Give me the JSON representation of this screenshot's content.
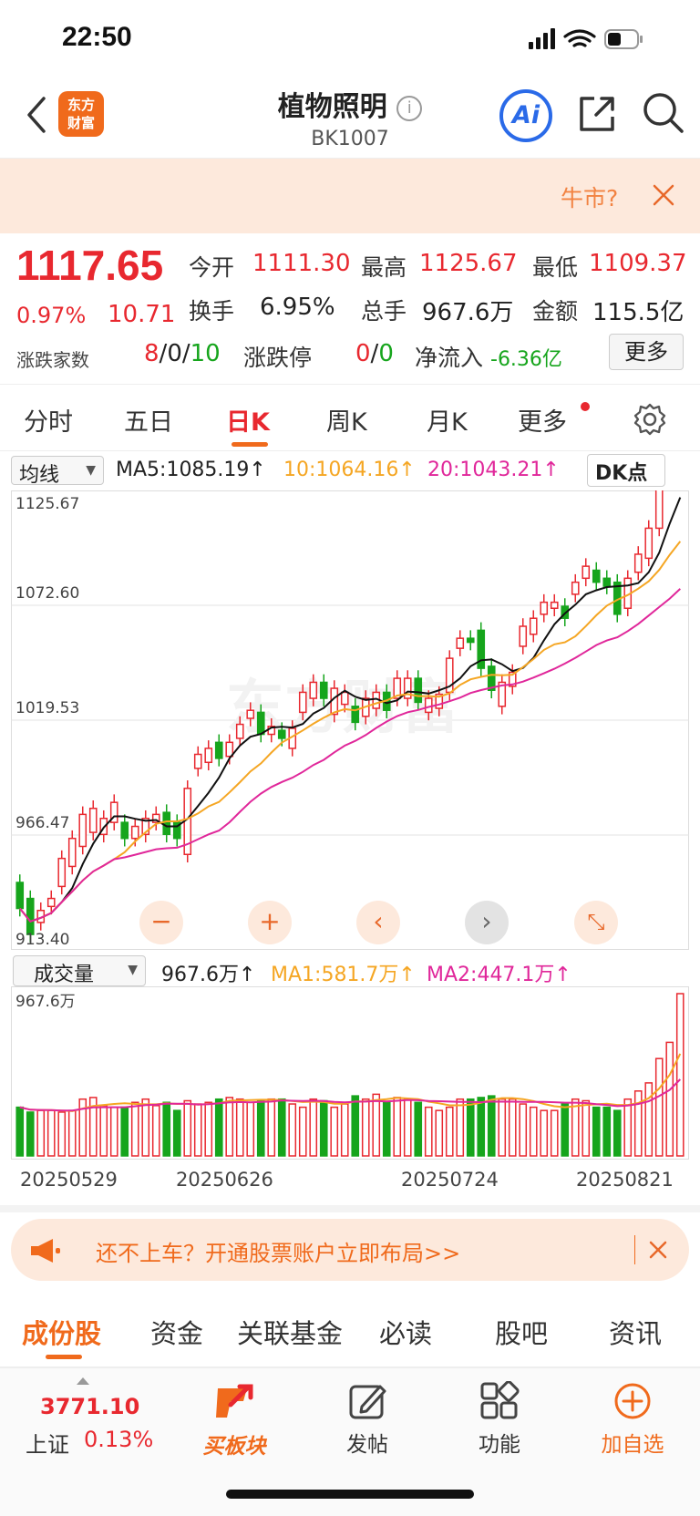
{
  "status_bar": {
    "time": "22:50"
  },
  "header": {
    "title": "植物照明",
    "code": "BK1007",
    "logo_text_1": "东方",
    "logo_text_2": "财富",
    "ai_label": "Ai"
  },
  "banner": {
    "text": "牛市?"
  },
  "quote": {
    "price": "1117.65",
    "change_pct": "0.97%",
    "change": "10.71",
    "open_label": "今开",
    "open": "1111.30",
    "high_label": "最高",
    "high": "1125.67",
    "low_label": "最低",
    "low": "1109.37",
    "turnover_label": "换手",
    "turnover": "6.95%",
    "volume_label": "总手",
    "volume": "967.6万",
    "amount_label": "金额",
    "amount": "115.5亿",
    "updown_label": "涨跌家数",
    "up": "8",
    "flat": "0",
    "down": "10",
    "limit_label": "涨跌停",
    "limit_up": "0",
    "limit_down": "0",
    "netflow_label": "净流入",
    "netflow": "-6.36亿",
    "more_button": "更多",
    "sep": "/"
  },
  "kline_tabs": [
    {
      "label": "分时"
    },
    {
      "label": "五日"
    },
    {
      "label": "日K"
    },
    {
      "label": "周K"
    },
    {
      "label": "月K"
    },
    {
      "label": "更多"
    }
  ],
  "ma_bar": {
    "selector": "均线",
    "ma5": "MA5:1085.19↑",
    "ma10": "10:1064.16↑",
    "ma20": "20:1043.21↑",
    "dk": "DK点"
  },
  "price_axis": [
    "1125.67",
    "1072.60",
    "1019.53",
    "966.47",
    "913.40"
  ],
  "vol_bar": {
    "selector": "成交量",
    "vol": "967.6万↑",
    "ma1": "MA1:581.7万↑",
    "ma2": "MA2:447.1万↑",
    "axis_max": "967.6万"
  },
  "date_axis": [
    "20250529",
    "20250626",
    "20250724",
    "20250821"
  ],
  "watermark": "东方财富",
  "chart_controls": [
    "−",
    "+",
    "‹",
    "›",
    "⤡"
  ],
  "ad": {
    "text": "还不上车？开通股票账户立即布局>>"
  },
  "sub_tabs": [
    {
      "label": "成份股"
    },
    {
      "label": "资金"
    },
    {
      "label": "关联基金"
    },
    {
      "label": "必读"
    },
    {
      "label": "股吧"
    },
    {
      "label": "资讯"
    }
  ],
  "bottom_bar": {
    "index_value": "3771.10",
    "index_name": "上证",
    "index_pct": "0.13%",
    "buy": "买板块",
    "post": "发帖",
    "func": "功能",
    "add": "加自选"
  },
  "colors": {
    "up": "#e8282f",
    "down": "#16a51c",
    "ma10": "#f5a623",
    "ma20": "#e0279a",
    "accent": "#f06a1c"
  },
  "chart_data": {
    "type": "candlestick",
    "ylim": [
      913.4,
      1125.67
    ],
    "candles": [
      {
        "o": 938,
        "c": 925
      },
      {
        "o": 930,
        "c": 912
      },
      {
        "o": 918,
        "c": 924
      },
      {
        "o": 926,
        "c": 930
      },
      {
        "o": 936,
        "c": 950
      },
      {
        "o": 946,
        "c": 960
      },
      {
        "o": 956,
        "c": 972
      },
      {
        "o": 963,
        "c": 975
      },
      {
        "o": 962,
        "c": 970
      },
      {
        "o": 968,
        "c": 978
      },
      {
        "o": 968,
        "c": 960
      },
      {
        "o": 960,
        "c": 966
      },
      {
        "o": 962,
        "c": 970
      },
      {
        "o": 968,
        "c": 972
      },
      {
        "o": 973,
        "c": 962
      },
      {
        "o": 968,
        "c": 960
      },
      {
        "o": 952,
        "c": 985
      },
      {
        "o": 995,
        "c": 1002
      },
      {
        "o": 998,
        "c": 1005
      },
      {
        "o": 1008,
        "c": 1000
      },
      {
        "o": 1001,
        "c": 1008
      },
      {
        "o": 1010,
        "c": 1017
      },
      {
        "o": 1020,
        "c": 1024
      },
      {
        "o": 1023,
        "c": 1012
      },
      {
        "o": 1012,
        "c": 1016
      },
      {
        "o": 1014,
        "c": 1010
      },
      {
        "o": 1005,
        "c": 1015
      },
      {
        "o": 1023,
        "c": 1033
      },
      {
        "o": 1030,
        "c": 1038
      },
      {
        "o": 1038,
        "c": 1030
      },
      {
        "o": 1022,
        "c": 1035
      },
      {
        "o": 1027,
        "c": 1033
      },
      {
        "o": 1026,
        "c": 1018
      },
      {
        "o": 1021,
        "c": 1030
      },
      {
        "o": 1025,
        "c": 1033
      },
      {
        "o": 1033,
        "c": 1024
      },
      {
        "o": 1030,
        "c": 1040
      },
      {
        "o": 1030,
        "c": 1040
      },
      {
        "o": 1040,
        "c": 1028
      },
      {
        "o": 1023,
        "c": 1030
      },
      {
        "o": 1025,
        "c": 1032
      },
      {
        "o": 1033,
        "c": 1050
      },
      {
        "o": 1055,
        "c": 1060
      },
      {
        "o": 1060,
        "c": 1058
      },
      {
        "o": 1064,
        "c": 1045
      },
      {
        "o": 1046,
        "c": 1034
      },
      {
        "o": 1026,
        "c": 1038
      },
      {
        "o": 1036,
        "c": 1043
      },
      {
        "o": 1056,
        "c": 1066
      },
      {
        "o": 1062,
        "c": 1070
      },
      {
        "o": 1072,
        "c": 1078
      },
      {
        "o": 1075,
        "c": 1078
      },
      {
        "o": 1076,
        "c": 1070
      },
      {
        "o": 1082,
        "c": 1088
      },
      {
        "o": 1090,
        "c": 1096
      },
      {
        "o": 1094,
        "c": 1088
      },
      {
        "o": 1090,
        "c": 1086
      },
      {
        "o": 1088,
        "c": 1072
      },
      {
        "o": 1075,
        "c": 1090
      },
      {
        "o": 1093,
        "c": 1102
      },
      {
        "o": 1100,
        "c": 1115
      },
      {
        "o": 1115,
        "c": 1135
      },
      {
        "o": 1140,
        "c": 1145
      },
      {
        "o": 1150,
        "c": 1155
      }
    ],
    "volume": [
      30,
      27,
      28,
      28,
      27,
      28,
      35,
      36,
      31,
      30,
      30,
      33,
      35,
      31,
      33,
      28,
      34,
      32,
      33,
      35,
      36,
      35,
      33,
      34,
      35,
      35,
      32,
      30,
      35,
      34,
      30,
      32,
      37,
      35,
      38,
      33,
      36,
      35,
      33,
      30,
      28,
      30,
      35,
      35,
      36,
      37,
      35,
      35,
      32,
      30,
      28,
      28,
      32,
      35,
      34,
      30,
      30,
      28,
      35,
      40,
      45,
      60,
      70,
      100
    ]
  }
}
